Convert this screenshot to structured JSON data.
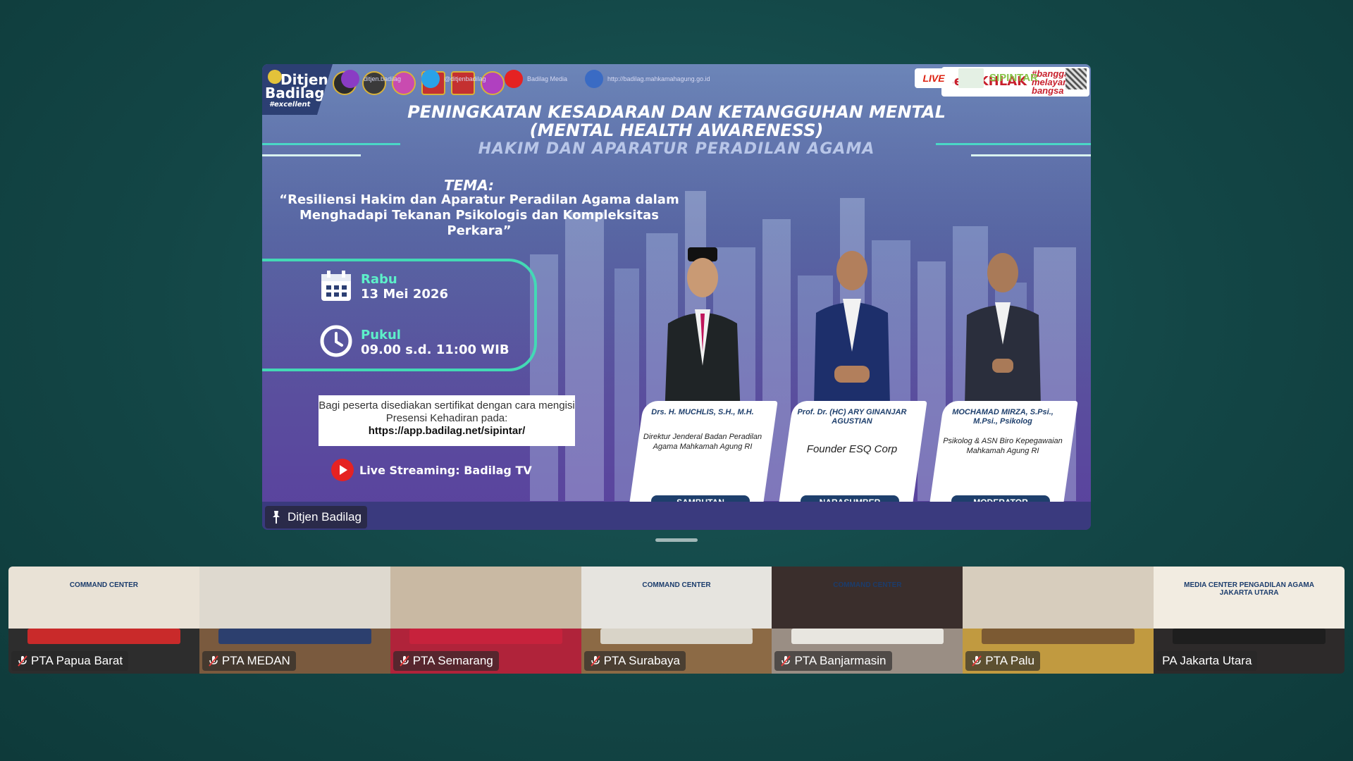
{
  "stage": {
    "logo": {
      "line1": "Ditjen",
      "line2": "Badilag",
      "line3": "#excellent"
    },
    "brand": {
      "main": "BerAKHLAK",
      "side": "#bangga melayani bangsa"
    },
    "title_line1": "PENINGKATAN KESADARAN DAN KETANGGUHAN MENTAL",
    "title_line2": "(MENTAL HEALTH AWARENESS)",
    "title_line3": "HAKIM DAN APARATUR PERADILAN AGAMA",
    "tema_label": "TEMA:",
    "tema_text": "“Resiliensi Hakim dan Aparatur Peradilan Agama dalam Menghadapi Tekanan Psikologis dan Kompleksitas Perkara”",
    "day_label": "Rabu",
    "date_value": "13 Mei 2026",
    "time_label": "Pukul",
    "time_value": "09.00 s.d. 11:00 WIB",
    "cert_text": "Bagi peserta disediakan sertifikat dengan cara mengisi Presensi Kehadiran pada:",
    "cert_url": "https://app.badilag.net/sipintar/",
    "stream_prefix": "Live Streaming: ",
    "stream_name": "Badilag TV",
    "speakers": [
      {
        "name": "Drs. H. MUCHLIS, S.H., M.H.",
        "role": "Direktur Jenderal Badan Peradilan Agama Mahkamah Agung RI",
        "tag": "SAMBUTAN"
      },
      {
        "name": "Prof. Dr. (HC) ARY GINANJAR AGUSTIAN",
        "role": "Founder ESQ Corp",
        "tag": "NARASUMBER"
      },
      {
        "name": "MOCHAMAD MIRZA, S.Psi., M.Psi., Psikolog",
        "role": "Psikolog & ASN Biro Kepegawaian Mahkamah Agung RI",
        "tag": "MODERATOR"
      }
    ],
    "social": [
      {
        "icon": "instagram-icon",
        "text": "ditjen.badilag",
        "color": "#8a3cc4"
      },
      {
        "icon": "twitter-icon",
        "text": "@ditjenbadilag",
        "color": "#2aa2e8"
      },
      {
        "icon": "youtube-icon",
        "text": "Badilag Media",
        "color": "#e52222"
      },
      {
        "icon": "globe-icon",
        "text": "http://badilag.mahkamahagung.go.id",
        "color": "#3a6bc4"
      }
    ],
    "footer_live": "LIVE",
    "footer_sipintar": "SIPINTAR",
    "participant_label": "Ditjen Badilag"
  },
  "thumbnails": [
    {
      "label": "PTA Papua Barat",
      "mic_muted": true,
      "wall": "#e9e2d6",
      "floor": "#2d2d2d",
      "table": "#c92a2a",
      "sign": "COMMAND CENTER"
    },
    {
      "label": "PTA MEDAN",
      "mic_muted": true,
      "wall": "#ded9cf",
      "floor": "#7a5a3e",
      "table": "#2c3f6e",
      "sign": ""
    },
    {
      "label": "PTA Semarang",
      "mic_muted": true,
      "wall": "#c9b9a3",
      "floor": "#b0233a",
      "table": "#c7223c",
      "sign": ""
    },
    {
      "label": "PTA Surabaya",
      "mic_muted": true,
      "wall": "#e6e4df",
      "floor": "#8c6a45",
      "table": "#d9d4c8",
      "sign": "COMMAND CENTER"
    },
    {
      "label": "PTA Banjarmasin",
      "mic_muted": true,
      "wall": "#3a2e2c",
      "floor": "#9a8e84",
      "table": "#e8e6e0",
      "sign": "COMMAND CENTER"
    },
    {
      "label": "PTA Palu",
      "mic_muted": true,
      "wall": "#d7cdbd",
      "floor": "#c19a40",
      "table": "#7c5a33",
      "sign": ""
    },
    {
      "label": "PA Jakarta Utara",
      "mic_muted": false,
      "wall": "#f2ece1",
      "floor": "#2d2a2a",
      "table": "#1e1e1e",
      "sign": "MEDIA CENTER PENGADILAN AGAMA JAKARTA UTARA"
    }
  ],
  "colors": {
    "accent": "#43d9b5",
    "background": "#134646",
    "navy": "#1e3f6c"
  }
}
